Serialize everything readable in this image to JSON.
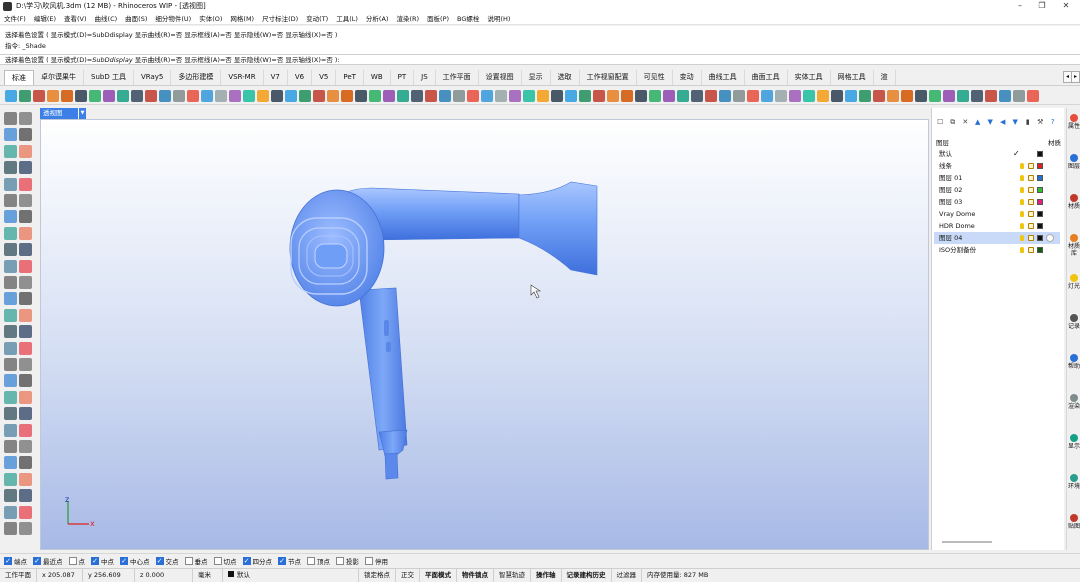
{
  "window": {
    "title": "D:\\学习\\吹风机.3dm (12 MB) - Rhinoceros WIP - [透视图]"
  },
  "menu": [
    "文件(F)",
    "编辑(E)",
    "查看(V)",
    "曲线(C)",
    "曲面(S)",
    "细分物件(U)",
    "实体(O)",
    "网格(M)",
    "尺寸标注(D)",
    "变动(T)",
    "工具(L)",
    "分析(A)",
    "渲染(R)",
    "面板(P)",
    "BG螺栓",
    "说明(H)"
  ],
  "command_history": [
    "选择着色设置 ( 显示模式(D)=SubDdisplay  显示曲线(R)=否  显示框线(A)=否  显示隐线(W)=否  显示轴线(X)=否 )",
    "指令: _Shade"
  ],
  "command_prompt": {
    "prefix": "选择着色设置 ( 显示模式(D)=",
    "mode": "SubDdisplay",
    "rest": "  显示曲线(R)=否  显示框线(A)=否  显示隐线(W)=否  显示轴线(X)=否 ):"
  },
  "tabs": [
    "标准",
    "卓尔谟果牛",
    "SubD 工具",
    "VRay5",
    "多边形建模",
    "VSR-MR",
    "V7",
    "V6",
    "V5",
    "PeT",
    "WB",
    "PT",
    "JS",
    "工作平面",
    "设置视图",
    "显示",
    "选取",
    "工作视窗配置",
    "可见性",
    "变动",
    "曲线工具",
    "曲面工具",
    "实体工具",
    "网格工具",
    "渲"
  ],
  "viewport": {
    "label": "透视图",
    "axis_x": "x",
    "axis_z": "z"
  },
  "layers": {
    "header": "图层",
    "material_header": "材质",
    "rows": [
      {
        "name": "默认",
        "current": "✓",
        "color": "#111111"
      },
      {
        "name": "线条",
        "color": "#e02020"
      },
      {
        "name": "图层 01",
        "color": "#1e73d2"
      },
      {
        "name": "图层 02",
        "color": "#2fbf2f"
      },
      {
        "name": "图层 03",
        "color": "#e0207a"
      },
      {
        "name": "Vray Dome",
        "color": "#111111"
      },
      {
        "name": "HDR Dome",
        "color": "#111111"
      },
      {
        "name": "图层 04",
        "color": "#111111",
        "selected": true
      },
      {
        "name": "ISO分割备份",
        "color": "#106010"
      }
    ]
  },
  "right_tabs": [
    "属性",
    "图层",
    "材质",
    "材质库",
    "灯光",
    "记录",
    "帮助",
    "渲染",
    "显示",
    "环境",
    "贴图"
  ],
  "osnaps": [
    {
      "label": "端点",
      "on": true
    },
    {
      "label": "最近点",
      "on": true
    },
    {
      "label": "点",
      "on": false
    },
    {
      "label": "中点",
      "on": true
    },
    {
      "label": "中心点",
      "on": true
    },
    {
      "label": "交点",
      "on": true
    },
    {
      "label": "垂点",
      "on": false
    },
    {
      "label": "切点",
      "on": false
    },
    {
      "label": "四分点",
      "on": true
    },
    {
      "label": "节点",
      "on": true
    },
    {
      "label": "顶点",
      "on": false
    },
    {
      "label": "投影",
      "on": false
    },
    {
      "label": "停用",
      "on": false
    }
  ],
  "status": {
    "cplane": "工作平面",
    "x": "x 205.087",
    "y": "y 256.609",
    "z": "z 0.000",
    "units": "毫米",
    "layer": "默认",
    "lock_grid": "锁定格点",
    "ortho": "正交",
    "planar": "平面模式",
    "osnap": "物件锁点",
    "smarttrack": "智慧轨迹",
    "gumball": "操作轴",
    "history": "记录建构历史",
    "filter": "过滤器",
    "memory": "内存使用量: 827 MB"
  },
  "colors": {
    "accent": "#3c7fe6",
    "model": "#6f9ef6"
  }
}
